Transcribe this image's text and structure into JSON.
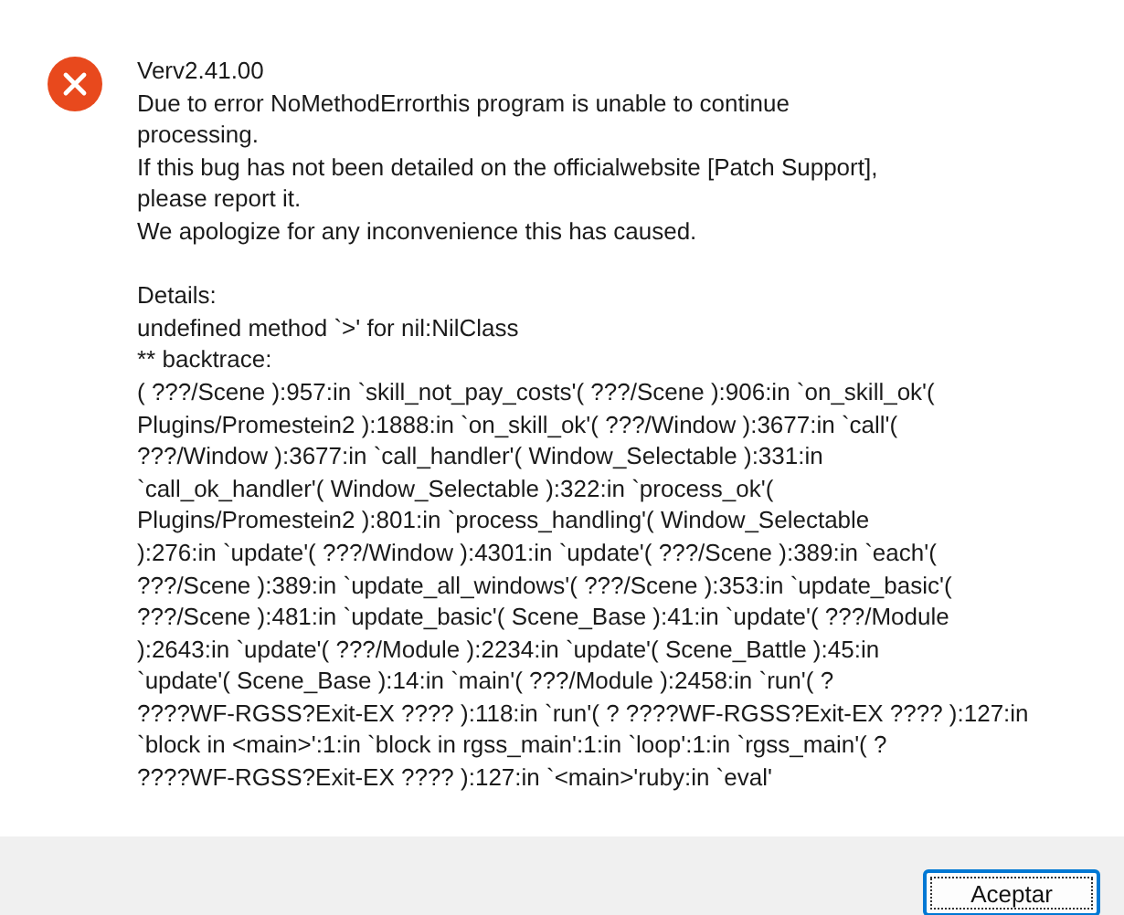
{
  "dialog": {
    "message_lines": [
      "Verv2.41.00",
      "Due to error NoMethodErrorthis program is unable to continue",
      "processing.",
      "If this bug has not been detailed on the officialwebsite [Patch Support],",
      "please report it.",
      "We apologize for any inconvenience this has caused."
    ],
    "details_lines": [
      "Details:",
      "undefined method `>' for nil:NilClass",
      "** backtrace:",
      "( ???/Scene ):957:in `skill_not_pay_costs'( ???/Scene ):906:in `on_skill_ok'(",
      "Plugins/Promestein2 ):1888:in `on_skill_ok'( ???/Window ):3677:in `call'(",
      "???/Window ):3677:in `call_handler'( Window_Selectable ):331:in",
      "`call_ok_handler'( Window_Selectable ):322:in `process_ok'(",
      "Plugins/Promestein2 ):801:in `process_handling'( Window_Selectable",
      "):276:in `update'( ???/Window ):4301:in `update'( ???/Scene ):389:in `each'(",
      "???/Scene ):389:in `update_all_windows'( ???/Scene ):353:in `update_basic'(",
      "???/Scene ):481:in `update_basic'( Scene_Base ):41:in `update'( ???/Module",
      "):2643:in `update'( ???/Module ):2234:in `update'( Scene_Battle ):45:in",
      "`update'( Scene_Base ):14:in `main'( ???/Module ):2458:in `run'( ?",
      "????WF-RGSS?Exit-EX ???? ):118:in `run'( ? ????WF-RGSS?Exit-EX ???? ):127:in",
      "`block in <main>':1:in `block in rgss_main':1:in `loop':1:in `rgss_main'( ?",
      "????WF-RGSS?Exit-EX ???? ):127:in `<main>'ruby:in `eval'"
    ]
  },
  "buttons": [
    {
      "label": "Aceptar",
      "selected": true
    }
  ]
}
